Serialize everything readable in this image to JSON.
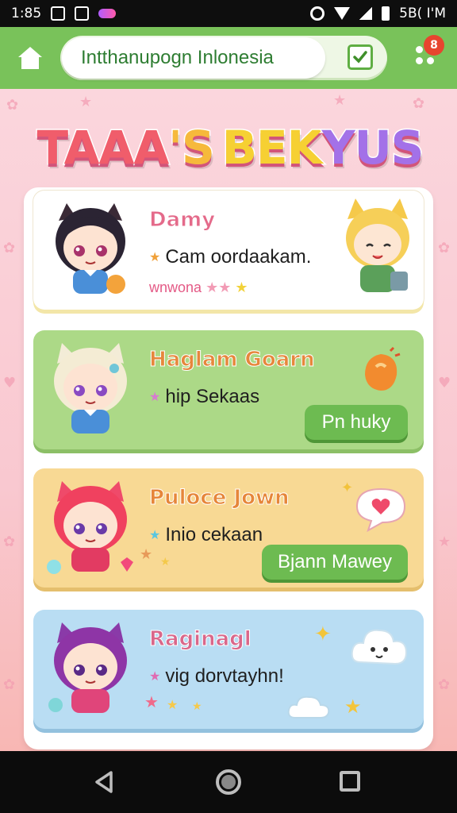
{
  "status_bar": {
    "time": "1:85",
    "right_text": "5B( I'M"
  },
  "app_bar": {
    "url_text": "Intthanupogn Inlonesia",
    "notification_count": "8"
  },
  "title": {
    "parts": [
      "TAAA",
      "'S",
      "BEK",
      "YUS"
    ],
    "colors": [
      "#f05d6b",
      "#f6b93b",
      "#f6d033",
      "#a371e8"
    ]
  },
  "cards": [
    {
      "title": "Damy",
      "subtitle": "Cam oordaakam.",
      "tag": "wnwona",
      "theme": "#ffffff"
    },
    {
      "title": "Haglam Goarn",
      "subtitle": "hip Sekaas",
      "action_label": "Pn huky",
      "theme": "#acd987"
    },
    {
      "title": "Puloce Jown",
      "subtitle": "Inio cekaan",
      "action_label": "Bjann Mawey",
      "theme": "#f8d994"
    },
    {
      "title": "Raginagl",
      "subtitle": "vig dorvtayhn!",
      "theme": "#b9ddf3"
    }
  ],
  "icons": {
    "status_left": [
      "image-icon",
      "cloud-icon",
      "app-badge-icon"
    ],
    "status_right": [
      "gear-icon",
      "wifi-icon",
      "signal-icon",
      "battery-icon"
    ],
    "app_bar": [
      "home-icon",
      "checkbox-icon",
      "menu-icon"
    ],
    "nav": [
      "back-icon",
      "home-circle-icon",
      "recents-icon"
    ]
  }
}
